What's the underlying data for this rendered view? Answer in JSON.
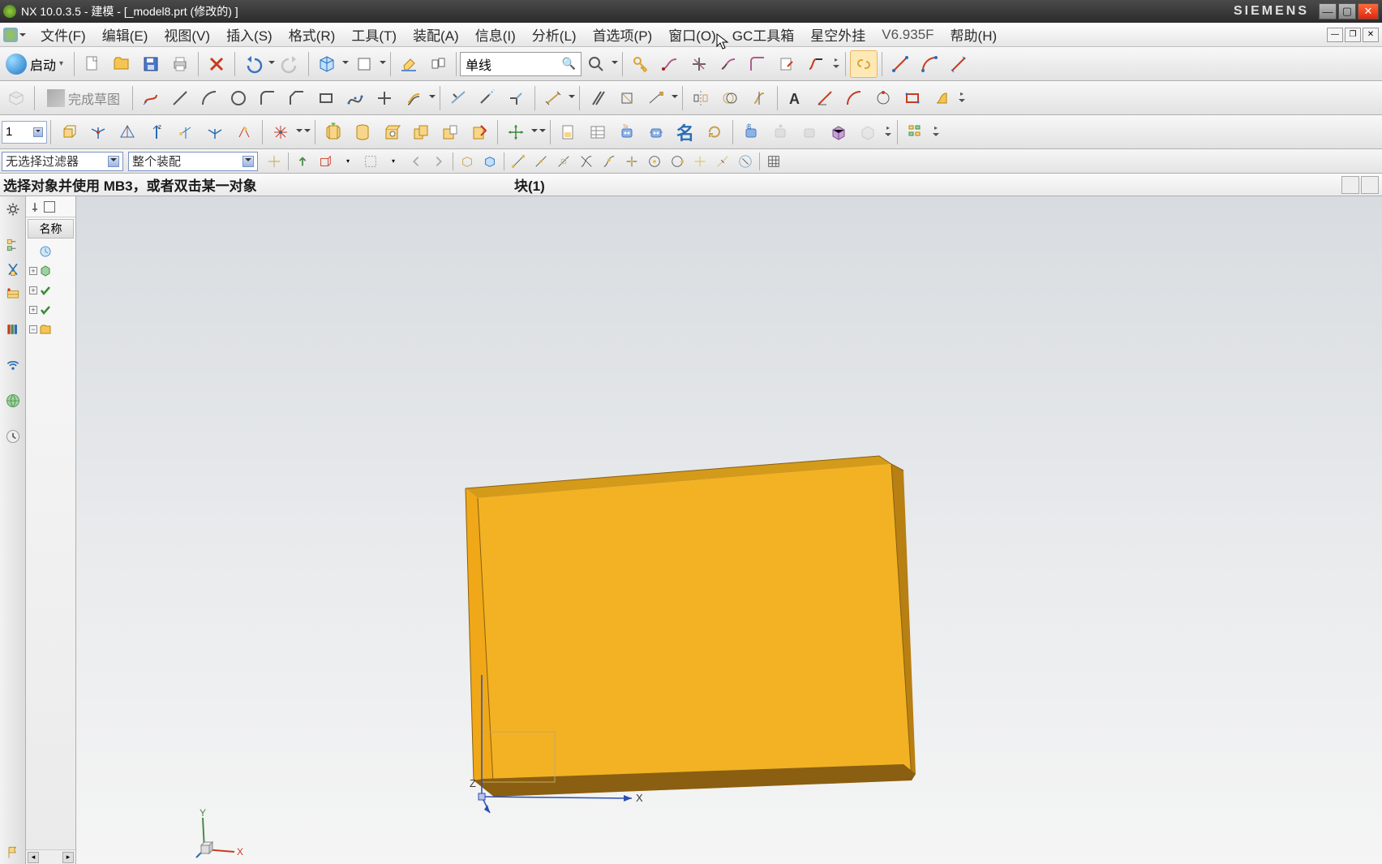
{
  "title": {
    "app": "NX 10.0.3.5 - 建模 - [_model8.prt  (修改的)  ]",
    "brand": "SIEMENS"
  },
  "menu": {
    "file": "文件(F)",
    "edit": "编辑(E)",
    "view": "视图(V)",
    "insert": "插入(S)",
    "format": "格式(R)",
    "tools": "工具(T)",
    "assemblies": "装配(A)",
    "information": "信息(I)",
    "analysis": "分析(L)",
    "preferences": "首选项(P)",
    "window": "窗口(O)",
    "gctoolbox": "GC工具箱",
    "plugin": "星空外挂",
    "version": "V6.935F",
    "help": "帮助(H)"
  },
  "toolbar1": {
    "start": "启动",
    "linetype": "单线"
  },
  "toolbar2": {
    "finish_sketch": "完成草图"
  },
  "toolbar3": {
    "spin_value": "1",
    "name_tool": "名"
  },
  "filter": {
    "selection_filter": "无选择过滤器",
    "scope": "整个装配"
  },
  "cue": {
    "prompt": "选择对象并使用 MB3，或者双击某一对象",
    "object": "块(1)"
  },
  "navigator": {
    "column": "名称",
    "items": [
      {
        "expand": "",
        "icon": "history-icon",
        "check": false
      },
      {
        "expand": "+",
        "icon": "model-views-icon",
        "check": false
      },
      {
        "expand": "+",
        "icon": "cameras-icon",
        "check": true
      },
      {
        "expand": "+",
        "icon": "user-expr-icon",
        "check": true
      },
      {
        "expand": "-",
        "icon": "model-history-icon",
        "check": false
      }
    ]
  },
  "viewport": {
    "axis_x": "X",
    "axis_y": "Y",
    "axis_z": "Z"
  }
}
